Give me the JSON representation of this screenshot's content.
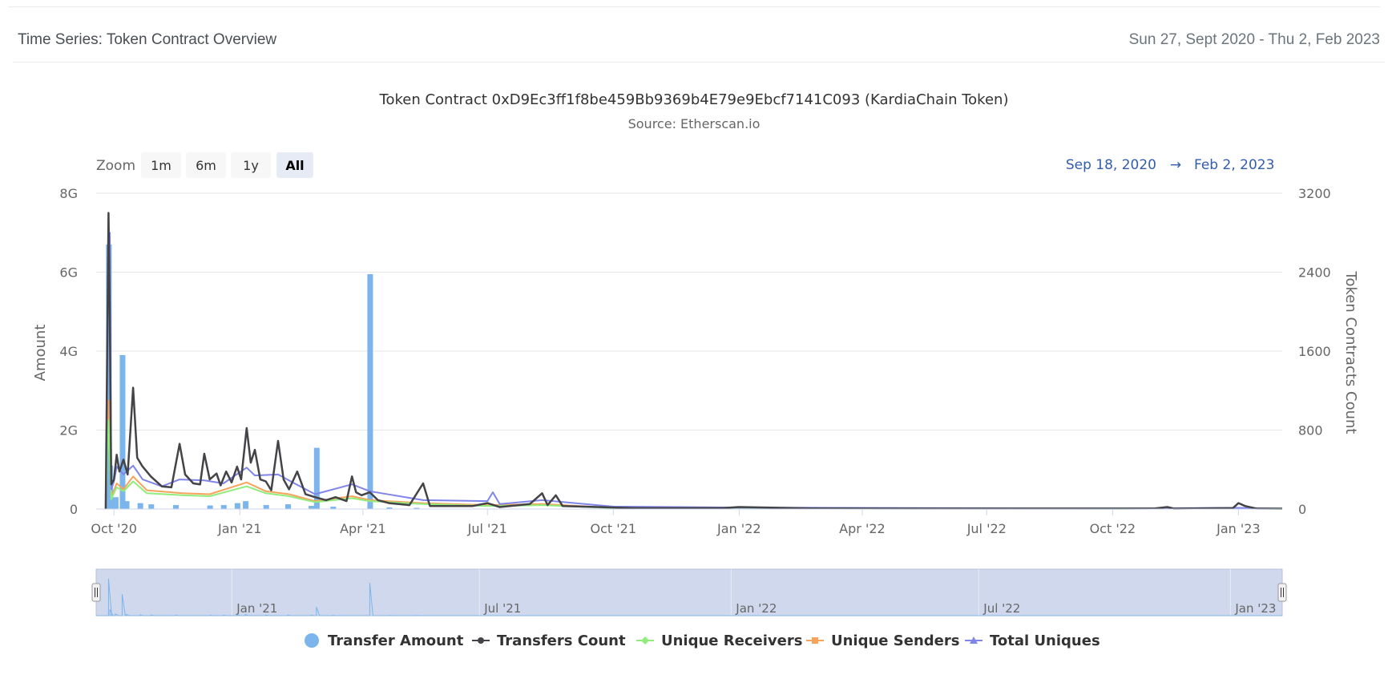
{
  "card": {
    "title": "Time Series: Token Contract Overview",
    "range": "Sun 27, Sept 2020 - Thu 2, Feb 2023"
  },
  "chart_data": {
    "type": "line",
    "title": "Token Contract 0xD9Ec3ff1f8be459Bb9369b4E79e9Ebcf7141C093 (KardiaChain Token)",
    "subtitle": "Source: Etherscan.io",
    "zoom": {
      "label": "Zoom",
      "buttons": [
        "1m",
        "6m",
        "1y",
        "All"
      ],
      "active": "All"
    },
    "range_selector": {
      "from": "Sep 18, 2020",
      "arrow": "→",
      "to": "Feb 2, 2023"
    },
    "x_axis": {
      "range": [
        "2020-09-18",
        "2023-02-02"
      ],
      "ticks": [
        {
          "date": "2020-10-01",
          "label": "Oct '20"
        },
        {
          "date": "2021-01-01",
          "label": "Jan '21"
        },
        {
          "date": "2021-04-01",
          "label": "Apr '21"
        },
        {
          "date": "2021-07-01",
          "label": "Jul '21"
        },
        {
          "date": "2021-10-01",
          "label": "Oct '21"
        },
        {
          "date": "2022-01-01",
          "label": "Jan '22"
        },
        {
          "date": "2022-04-01",
          "label": "Apr '22"
        },
        {
          "date": "2022-07-01",
          "label": "Jul '22"
        },
        {
          "date": "2022-10-01",
          "label": "Oct '22"
        },
        {
          "date": "2023-01-01",
          "label": "Jan '23"
        }
      ]
    },
    "y_left": {
      "label": "Amount",
      "ylim": [
        0,
        8000000000
      ],
      "ticks": [
        {
          "v": 0,
          "label": "0"
        },
        {
          "v": 2000000000,
          "label": "2G"
        },
        {
          "v": 4000000000,
          "label": "4G"
        },
        {
          "v": 6000000000,
          "label": "6G"
        },
        {
          "v": 8000000000,
          "label": "8G"
        }
      ]
    },
    "y_right": {
      "label": "Token Contracts Count",
      "ylim": [
        0,
        3200
      ],
      "ticks": [
        {
          "v": 0,
          "label": "0"
        },
        {
          "v": 800,
          "label": "800"
        },
        {
          "v": 1600,
          "label": "1600"
        },
        {
          "v": 2400,
          "label": "2400"
        },
        {
          "v": 3200,
          "label": "3200"
        }
      ]
    },
    "grid": true,
    "legend_position": "bottom-center",
    "navigator_labels": [
      {
        "date": "2021-01-01",
        "label": "Jan '21"
      },
      {
        "date": "2021-07-01",
        "label": "Jul '21"
      },
      {
        "date": "2022-01-01",
        "label": "Jan '22"
      },
      {
        "date": "2022-07-01",
        "label": "Jul '22"
      },
      {
        "date": "2023-01-01",
        "label": "Jan '23"
      }
    ],
    "series": [
      {
        "name": "Transfer Amount",
        "type": "column",
        "axis": "left",
        "color": "#7cb5ec",
        "points": [
          [
            "2020-09-27",
            6700000000
          ],
          [
            "2020-09-28",
            1100000000
          ],
          [
            "2020-10-02",
            300000000
          ],
          [
            "2020-10-07",
            3900000000
          ],
          [
            "2020-10-10",
            200000000
          ],
          [
            "2020-10-20",
            150000000
          ],
          [
            "2020-10-28",
            120000000
          ],
          [
            "2020-11-15",
            100000000
          ],
          [
            "2020-12-10",
            90000000
          ],
          [
            "2020-12-20",
            100000000
          ],
          [
            "2020-12-30",
            150000000
          ],
          [
            "2021-01-05",
            200000000
          ],
          [
            "2021-01-20",
            100000000
          ],
          [
            "2021-02-05",
            120000000
          ],
          [
            "2021-02-22",
            80000000
          ],
          [
            "2021-02-26",
            1550000000
          ],
          [
            "2021-03-10",
            60000000
          ],
          [
            "2021-04-06",
            5950000000
          ],
          [
            "2021-04-20",
            40000000
          ],
          [
            "2021-05-10",
            30000000
          ]
        ]
      },
      {
        "name": "Transfers Count",
        "type": "line",
        "axis": "right",
        "color": "#434348",
        "points": [
          [
            "2020-09-25",
            0
          ],
          [
            "2020-09-27",
            3000
          ],
          [
            "2020-09-28",
            1900
          ],
          [
            "2020-09-29",
            250
          ],
          [
            "2020-10-01",
            300
          ],
          [
            "2020-10-03",
            550
          ],
          [
            "2020-10-05",
            380
          ],
          [
            "2020-10-08",
            500
          ],
          [
            "2020-10-11",
            350
          ],
          [
            "2020-10-15",
            1230
          ],
          [
            "2020-10-18",
            520
          ],
          [
            "2020-10-22",
            430
          ],
          [
            "2020-10-28",
            330
          ],
          [
            "2020-11-05",
            230
          ],
          [
            "2020-11-12",
            220
          ],
          [
            "2020-11-18",
            660
          ],
          [
            "2020-11-22",
            350
          ],
          [
            "2020-11-28",
            260
          ],
          [
            "2020-12-03",
            250
          ],
          [
            "2020-12-06",
            560
          ],
          [
            "2020-12-10",
            300
          ],
          [
            "2020-12-15",
            360
          ],
          [
            "2020-12-18",
            240
          ],
          [
            "2020-12-22",
            380
          ],
          [
            "2020-12-26",
            270
          ],
          [
            "2020-12-30",
            430
          ],
          [
            "2021-01-02",
            300
          ],
          [
            "2021-01-06",
            820
          ],
          [
            "2021-01-09",
            470
          ],
          [
            "2021-01-12",
            600
          ],
          [
            "2021-01-16",
            300
          ],
          [
            "2021-01-20",
            280
          ],
          [
            "2021-01-24",
            190
          ],
          [
            "2021-01-29",
            690
          ],
          [
            "2021-02-02",
            300
          ],
          [
            "2021-02-06",
            200
          ],
          [
            "2021-02-12",
            380
          ],
          [
            "2021-02-18",
            150
          ],
          [
            "2021-02-25",
            120
          ],
          [
            "2021-03-05",
            90
          ],
          [
            "2021-03-12",
            120
          ],
          [
            "2021-03-20",
            80
          ],
          [
            "2021-03-24",
            330
          ],
          [
            "2021-03-27",
            170
          ],
          [
            "2021-03-31",
            140
          ],
          [
            "2021-04-06",
            170
          ],
          [
            "2021-04-12",
            90
          ],
          [
            "2021-04-20",
            60
          ],
          [
            "2021-05-05",
            40
          ],
          [
            "2021-05-15",
            260
          ],
          [
            "2021-05-20",
            30
          ],
          [
            "2021-06-10",
            30
          ],
          [
            "2021-06-20",
            30
          ],
          [
            "2021-07-01",
            60
          ],
          [
            "2021-07-10",
            20
          ],
          [
            "2021-08-01",
            50
          ],
          [
            "2021-08-10",
            160
          ],
          [
            "2021-08-14",
            40
          ],
          [
            "2021-08-20",
            140
          ],
          [
            "2021-08-25",
            30
          ],
          [
            "2021-09-20",
            20
          ],
          [
            "2021-10-15",
            10
          ],
          [
            "2021-11-20",
            10
          ],
          [
            "2021-12-20",
            10
          ],
          [
            "2022-01-01",
            20
          ],
          [
            "2022-03-01",
            6
          ],
          [
            "2022-06-01",
            5
          ],
          [
            "2022-09-01",
            5
          ],
          [
            "2022-11-01",
            6
          ],
          [
            "2022-11-10",
            20
          ],
          [
            "2022-11-15",
            4
          ],
          [
            "2022-12-28",
            10
          ],
          [
            "2023-01-01",
            60
          ],
          [
            "2023-01-06",
            30
          ],
          [
            "2023-01-14",
            5
          ],
          [
            "2023-02-02",
            4
          ]
        ]
      },
      {
        "name": "Unique Receivers",
        "type": "line",
        "axis": "right",
        "color": "#90ed7d",
        "points": [
          [
            "2020-09-25",
            0
          ],
          [
            "2020-09-27",
            900
          ],
          [
            "2020-09-29",
            100
          ],
          [
            "2020-10-03",
            220
          ],
          [
            "2020-10-08",
            180
          ],
          [
            "2020-10-15",
            280
          ],
          [
            "2020-10-25",
            160
          ],
          [
            "2020-11-20",
            140
          ],
          [
            "2020-12-10",
            130
          ],
          [
            "2021-01-06",
            230
          ],
          [
            "2021-01-20",
            160
          ],
          [
            "2021-02-06",
            130
          ],
          [
            "2021-02-25",
            70
          ],
          [
            "2021-03-24",
            110
          ],
          [
            "2021-04-06",
            80
          ],
          [
            "2021-05-15",
            50
          ],
          [
            "2021-07-01",
            30
          ],
          [
            "2021-08-10",
            40
          ],
          [
            "2021-10-01",
            10
          ],
          [
            "2022-01-01",
            8
          ],
          [
            "2022-10-01",
            3
          ],
          [
            "2023-01-01",
            6
          ],
          [
            "2023-02-02",
            2
          ]
        ]
      },
      {
        "name": "Unique Senders",
        "type": "line",
        "axis": "right",
        "color": "#f7a35c",
        "points": [
          [
            "2020-09-25",
            0
          ],
          [
            "2020-09-27",
            1100
          ],
          [
            "2020-09-29",
            120
          ],
          [
            "2020-10-03",
            260
          ],
          [
            "2020-10-08",
            200
          ],
          [
            "2020-10-15",
            330
          ],
          [
            "2020-10-25",
            190
          ],
          [
            "2020-11-20",
            160
          ],
          [
            "2020-12-10",
            150
          ],
          [
            "2021-01-06",
            270
          ],
          [
            "2021-01-20",
            180
          ],
          [
            "2021-02-06",
            150
          ],
          [
            "2021-02-25",
            80
          ],
          [
            "2021-03-24",
            130
          ],
          [
            "2021-04-06",
            90
          ],
          [
            "2021-05-15",
            60
          ],
          [
            "2021-07-01",
            40
          ],
          [
            "2021-08-10",
            50
          ],
          [
            "2021-10-01",
            12
          ],
          [
            "2022-01-01",
            9
          ],
          [
            "2022-10-01",
            4
          ],
          [
            "2023-01-01",
            8
          ],
          [
            "2023-02-02",
            3
          ]
        ]
      },
      {
        "name": "Total Uniques",
        "type": "line",
        "axis": "right",
        "color": "#8085e9",
        "points": [
          [
            "2020-09-25",
            0
          ],
          [
            "2020-09-27",
            2400
          ],
          [
            "2020-09-28",
            2800
          ],
          [
            "2020-09-29",
            200
          ],
          [
            "2020-10-01",
            280
          ],
          [
            "2020-10-03",
            430
          ],
          [
            "2020-10-08",
            350
          ],
          [
            "2020-10-15",
            440
          ],
          [
            "2020-10-22",
            300
          ],
          [
            "2020-11-05",
            230
          ],
          [
            "2020-11-18",
            300
          ],
          [
            "2020-12-06",
            290
          ],
          [
            "2020-12-20",
            260
          ],
          [
            "2021-01-06",
            420
          ],
          [
            "2021-01-12",
            340
          ],
          [
            "2021-01-29",
            350
          ],
          [
            "2021-02-10",
            260
          ],
          [
            "2021-02-25",
            150
          ],
          [
            "2021-03-24",
            250
          ],
          [
            "2021-04-06",
            180
          ],
          [
            "2021-05-15",
            90
          ],
          [
            "2021-07-01",
            80
          ],
          [
            "2021-07-05",
            170
          ],
          [
            "2021-07-10",
            50
          ],
          [
            "2021-08-10",
            90
          ],
          [
            "2021-10-01",
            25
          ],
          [
            "2022-01-01",
            15
          ],
          [
            "2022-10-01",
            6
          ],
          [
            "2023-01-01",
            12
          ],
          [
            "2023-02-02",
            4
          ]
        ]
      }
    ]
  }
}
